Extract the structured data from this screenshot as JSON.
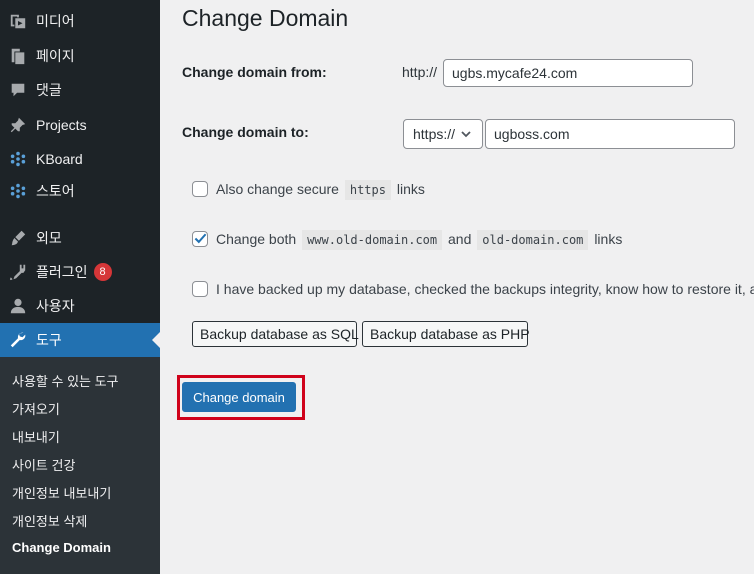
{
  "sidebar": {
    "items": [
      {
        "label": "미디어",
        "icon": "media-icon"
      },
      {
        "label": "페이지",
        "icon": "page-icon"
      },
      {
        "label": "댓글",
        "icon": "comment-icon"
      },
      {
        "label": "Projects",
        "icon": "pin-icon"
      },
      {
        "label": "KBoard",
        "icon": "dots-icon"
      },
      {
        "label": "스토어",
        "icon": "dots-icon"
      },
      {
        "label": "외모",
        "icon": "brush-icon"
      },
      {
        "label": "플러그인",
        "icon": "plugin-icon",
        "badge": "8"
      },
      {
        "label": "사용자",
        "icon": "user-icon"
      },
      {
        "label": "도구",
        "icon": "wrench-icon",
        "active": true
      }
    ],
    "submenu": [
      "사용할 수 있는 도구",
      "가져오기",
      "내보내기",
      "사이트 건강",
      "개인정보 내보내기",
      "개인정보 삭제",
      "Change Domain"
    ]
  },
  "main": {
    "title": "Change Domain",
    "from_label": "Change domain from:",
    "from_prefix": "http://",
    "from_value": "ugbs.mycafe24.com",
    "to_label": "Change domain to:",
    "to_protocol": "https://",
    "to_value": "ugboss.com",
    "opt1": {
      "checked": false,
      "pre": "Also change secure",
      "code": "https",
      "post": "links"
    },
    "opt2": {
      "checked": true,
      "pre": "Change both",
      "code1": "www.old-domain.com",
      "mid": "and",
      "code2": "old-domain.com",
      "post": "links"
    },
    "opt3": {
      "checked": false,
      "text": "I have backed up my database, checked the backups integrity, know how to restore it, a"
    },
    "backup_sql_label": "Backup database as SQL",
    "backup_php_label": "Backup database as PHP",
    "submit_label": "Change domain"
  },
  "colors": {
    "sidebar_bg": "#1d2327",
    "submenu_bg": "#2c3338",
    "accent": "#2271b1",
    "badge": "#d63638",
    "highlight": "#d0021b"
  }
}
